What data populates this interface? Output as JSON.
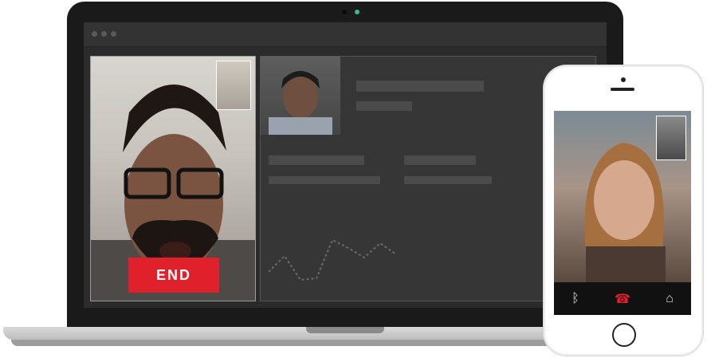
{
  "call": {
    "end_label": "END"
  },
  "icons": {
    "pip_left": "participant-thumbnail",
    "phone_bluetooth": "bluetooth-icon",
    "phone_hangup": "hangup-icon",
    "phone_switch_camera": "switch-camera-icon"
  },
  "colors": {
    "end": "#e0202a",
    "camera_led": "#2fbf8a"
  }
}
